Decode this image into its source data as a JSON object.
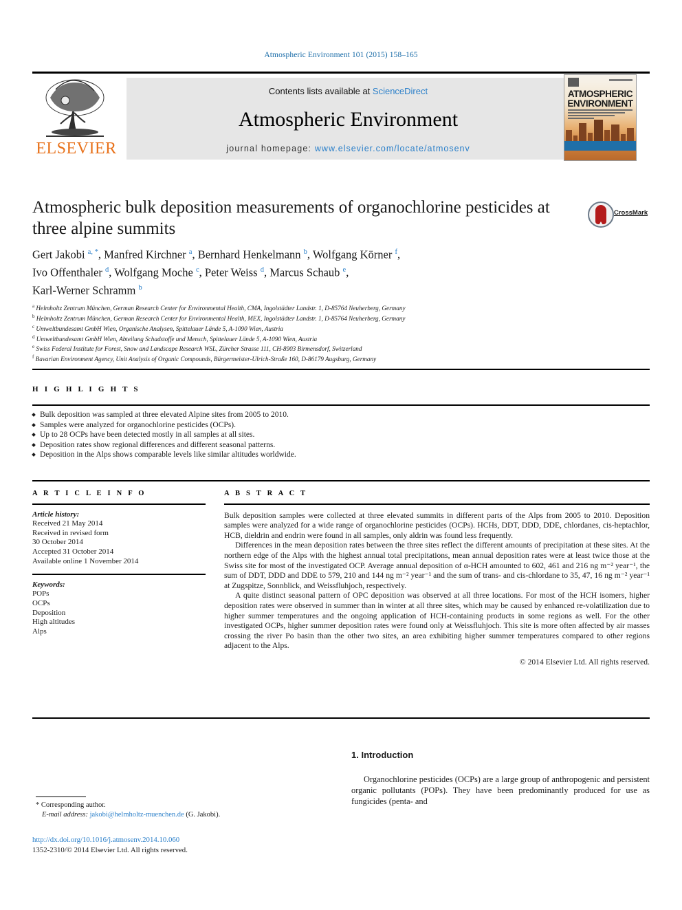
{
  "running_head": "Atmospheric Environment 101 (2015) 158–165",
  "masthead": {
    "contents_prefix": "Contents lists available at ",
    "sciencedirect": "ScienceDirect",
    "journal_name": "Atmospheric Environment",
    "homepage_label": "journal homepage: ",
    "homepage_url": "www.elsevier.com/locate/atmosenv",
    "publisher_logo_text": "ELSEVIER",
    "cover_title_line1": "ATMOSPHERIC",
    "cover_title_line2": "ENVIRONMENT"
  },
  "crossmark": {
    "label": "CrossMark"
  },
  "article": {
    "title": "Atmospheric bulk deposition measurements of organochlorine pesticides at three alpine summits",
    "authors_line1": "Gert Jakobi <sup>a, *</sup>, Manfred Kirchner <sup>a</sup>, Bernhard Henkelmann <sup>b</sup>, Wolfgang Körner <sup>f</sup>,",
    "authors_line2": "Ivo Offenthaler <sup>d</sup>, Wolfgang Moche <sup>c</sup>, Peter Weiss <sup>d</sup>, Marcus Schaub <sup>e</sup>,",
    "authors_line3": "Karl-Werner Schramm <sup>b</sup>",
    "affiliations": [
      "<sup>a</sup> Helmholtz Zentrum München, German Research Center for Environmental Health, CMA, Ingolstädter Landstr. 1, D-85764 Neuherberg, Germany",
      "<sup>b</sup> Helmholtz Zentrum München, German Research Center for Environmental Health, MEX, Ingolstädter Landstr. 1, D-85764 Neuherberg, Germany",
      "<sup>c</sup> Umweltbundesamt GmbH Wien, Organische Analysen, Spittelauer Lände 5, A-1090 Wien, Austria",
      "<sup>d</sup> Umweltbundesamt GmbH Wien, Abteilung Schadstoffe und Mensch, Spittelauer Lände 5, A-1090 Wien, Austria",
      "<sup>e</sup> Swiss Federal Institute for Forest, Snow and Landscape Research WSL, Zürcher Strasse 111, CH-8903 Birmensdorf, Switzerland",
      "<sup>f</sup> Bavarian Environment Agency, Unit Analysis of Organic Compounds, Bürgermeister-Ulrich-Straße 160, D-86179 Augsburg, Germany"
    ]
  },
  "highlights": {
    "heading": "H I G H L I G H T S",
    "items": [
      "Bulk deposition was sampled at three elevated Alpine sites from 2005 to 2010.",
      "Samples were analyzed for organochlorine pesticides (OCPs).",
      "Up to 28 OCPs have been detected mostly in all samples at all sites.",
      "Deposition rates show regional differences and different seasonal patterns.",
      "Deposition in the Alps shows comparable levels like similar altitudes worldwide."
    ]
  },
  "article_info": {
    "heading": "A R T I C L E   I N F O",
    "history_label": "Article history:",
    "history": [
      "Received 21 May 2014",
      "Received in revised form",
      "30 October 2014",
      "Accepted 31 October 2014",
      "Available online 1 November 2014"
    ],
    "keywords_label": "Keywords:",
    "keywords": [
      "POPs",
      "OCPs",
      "Deposition",
      "High altitudes",
      "Alps"
    ]
  },
  "abstract": {
    "heading": "A B S T R A C T",
    "paragraphs": [
      "Bulk deposition samples were collected at three elevated summits in different parts of the Alps from 2005 to 2010. Deposition samples were analyzed for a wide range of organochlorine pesticides (OCPs). HCHs, DDT, DDD, DDE, chlordanes, cis-heptachlor, HCB, dieldrin and endrin were found in all samples, only aldrin was found less frequently.",
      "Differences in the mean deposition rates between the three sites reflect the different amounts of precipitation at these sites. At the northern edge of the Alps with the highest annual total precipitations, mean annual deposition rates were at least twice those at the Swiss site for most of the investigated OCP. Average annual deposition of α-HCH amounted to 602, 461 and 216 ng m⁻² year⁻¹, the sum of DDT, DDD and DDE to 579, 210 and 144 ng m⁻² year⁻¹ and the sum of trans- and cis-chlordane to 35, 47, 16 ng m⁻² year⁻¹ at Zugspitze, Sonnblick, and Weissfluhjoch, respectively.",
      "A quite distinct seasonal pattern of OPC deposition was observed at all three locations. For most of the HCH isomers, higher deposition rates were observed in summer than in winter at all three sites, which may be caused by enhanced re-volatilization due to higher summer temperatures and the ongoing application of HCH-containing products in some regions as well. For the other investigated OCPs, higher summer deposition rates were found only at Weissfluhjoch. This site is more often affected by air masses crossing the river Po basin than the other two sites, an area exhibiting higher summer temperatures compared to other regions adjacent to the Alps."
    ],
    "copyright": "© 2014 Elsevier Ltd. All rights reserved."
  },
  "body": {
    "intro_heading": "1. Introduction",
    "intro_paragraph": "Organochlorine pesticides (OCPs) are a large group of anthropogenic and persistent organic pollutants (POPs). They have been predominantly produced for use as fungicides (penta- and"
  },
  "footer": {
    "corresponding_author": "* Corresponding author.",
    "email_label": "E-mail address: ",
    "email": "jakobi@helmholtz-muenchen.de",
    "email_suffix": " (G. Jakobi).",
    "doi": "http://dx.doi.org/10.1016/j.atmosenv.2014.10.060",
    "issn_line": "1352-2310/© 2014 Elsevier Ltd. All rights reserved."
  }
}
